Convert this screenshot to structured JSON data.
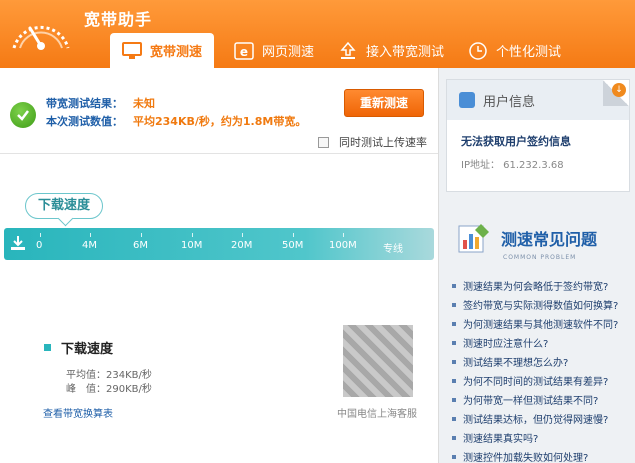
{
  "app": {
    "title": "宽带助手"
  },
  "tabs": [
    {
      "label": "宽带测速",
      "icon": "monitor-icon"
    },
    {
      "label": "网页测速",
      "icon": "ie-icon"
    },
    {
      "label": "接入带宽测试",
      "icon": "upload-icon"
    },
    {
      "label": "个性化测试",
      "icon": "clock-icon"
    }
  ],
  "result": {
    "result_label": "带宽测试结果：",
    "result_value": "未知",
    "value_label": "本次测试数值：",
    "value_text": "平均234KB/秒，约为1.8M带宽。",
    "retest_label": "重新测速",
    "upload_label": "同时测试上传速率"
  },
  "gauge": {
    "bubble": "下载速度",
    "ticks": [
      "0",
      "4M",
      "6M",
      "10M",
      "20M",
      "50M",
      "100M",
      "专线"
    ]
  },
  "download": {
    "title": "下载速度",
    "avg": "平均值：234KB/秒",
    "peak": "峰　值：290KB/秒",
    "link": "查看带宽换算表",
    "qr_caption": "中国电信上海客服"
  },
  "user": {
    "title": "用户信息",
    "message": "无法获取用户签约信息",
    "ip": "IP地址：  61.232.3.68"
  },
  "faq": {
    "title": "测速常见问题",
    "subtitle": "COMMON PROBLEM",
    "items": [
      "测速结果为何会略低于签约带宽?",
      "签约带宽与实际测得数值如何换算?",
      "为何测速结果与其他测速软件不同?",
      "测速时应注意什么?",
      "测试结果不理想怎么办?",
      "为何不同时间的测试结果有差异?",
      "为何带宽一样但测试结果不同?",
      "测试结果达标，但仍觉得网速慢?",
      "测速结果真实吗?",
      "测速控件加载失败如何处理?"
    ]
  },
  "colors": {
    "accent": "#f57a14",
    "teal": "#29b5bc",
    "link": "#1f5fa8"
  }
}
